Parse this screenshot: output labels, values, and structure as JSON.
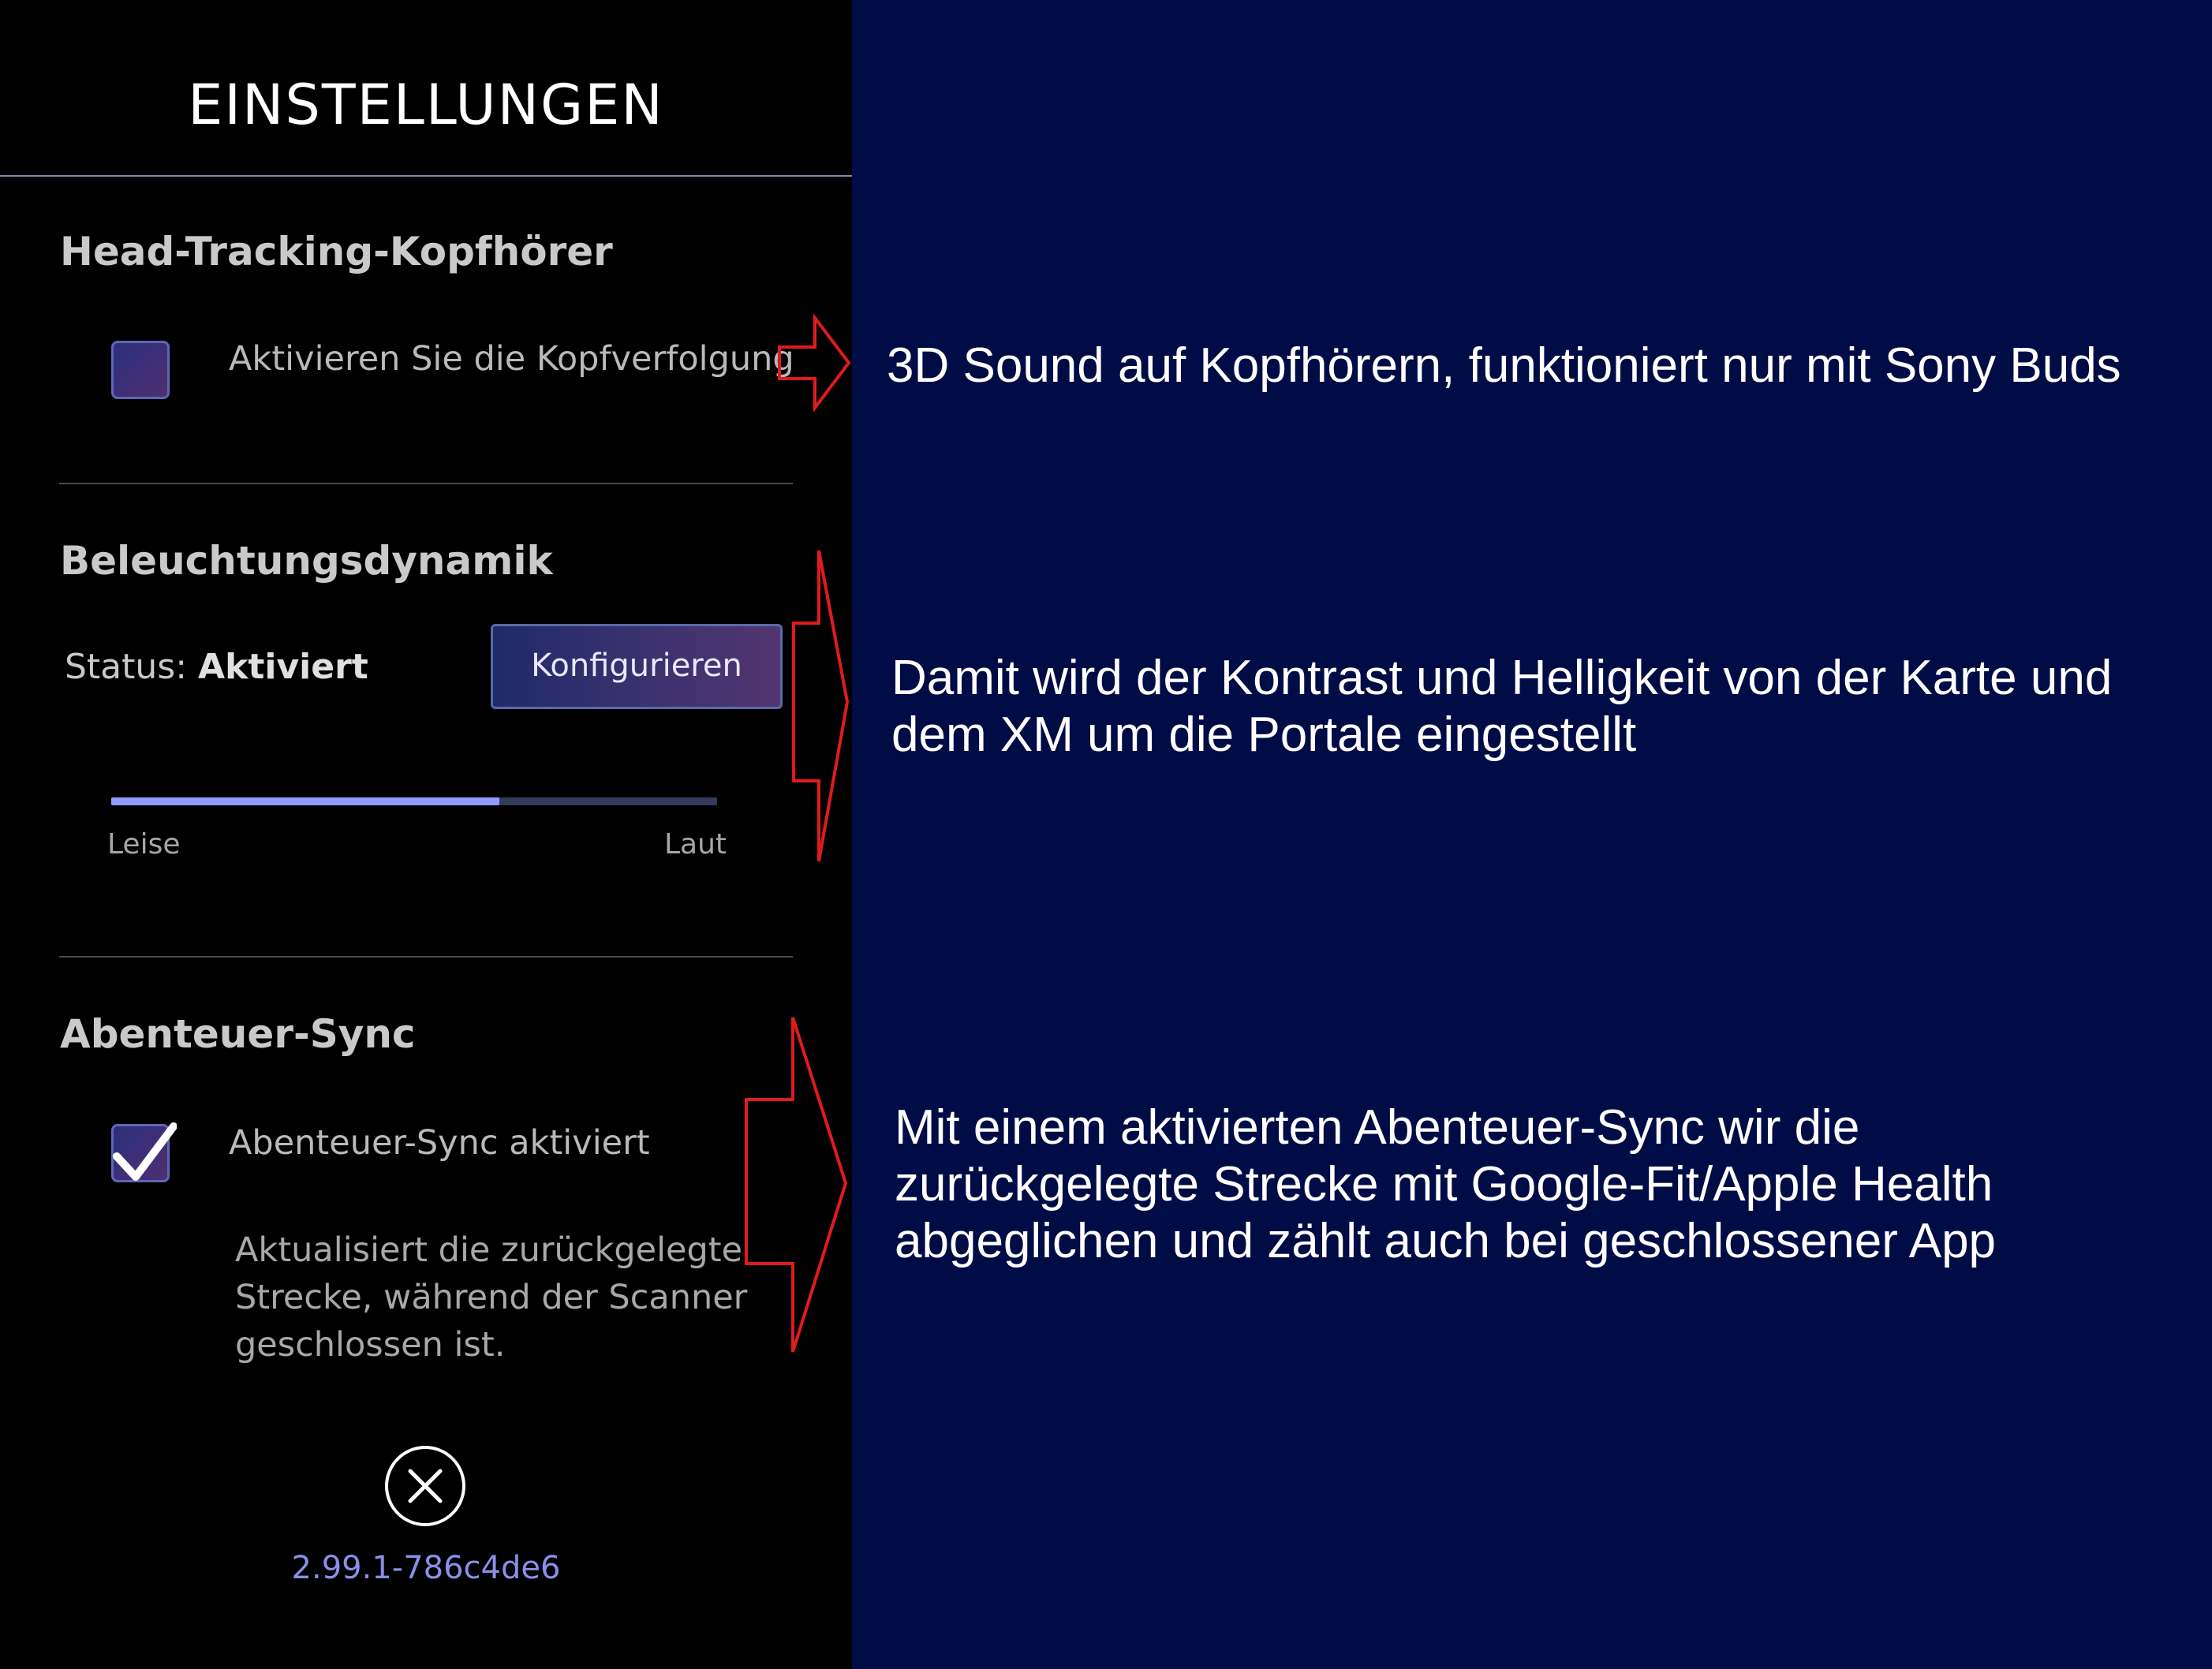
{
  "settings": {
    "title": "EINSTELLUNGEN",
    "head_tracking": {
      "heading": "Head-Tracking-Kopfhörer",
      "checkbox_label": "Aktivieren Sie die Kopfverfolgung",
      "checked": false
    },
    "lighting": {
      "heading": "Beleuchtungsdynamik",
      "status_label": "Status:",
      "status_value": "Aktiviert",
      "configure_button": "Konfigurieren",
      "slider": {
        "min_label": "Leise",
        "max_label": "Laut",
        "value": 0.64
      }
    },
    "adventure_sync": {
      "heading": "Abenteuer-Sync",
      "checkbox_label": "Abenteuer-Sync aktiviert",
      "checked": true,
      "description": "Aktualisiert die zurückgelegte Strecke, während der Scanner geschlossen ist."
    },
    "close_icon": "close-circle-icon",
    "version": "2.99.1-786c4de6"
  },
  "annotations": {
    "note1": "3D Sound auf Kopfhörern, funktioniert nur mit Sony Buds",
    "note2": "Damit wird der Kontrast und Helligkeit von der Karte und\ndem XM um die Portale eingestellt",
    "note3": "Mit einem aktivierten Abenteuer-Sync wir die\nzurückgelegte Strecke mit Google-Fit/Apple Health\nabgeglichen und zählt auch bei geschlossener App",
    "arrow_color": "#e01b1b"
  },
  "colors": {
    "panel_background": "#000000",
    "annotation_background": "#000c46",
    "accent": "#8f9cff"
  }
}
